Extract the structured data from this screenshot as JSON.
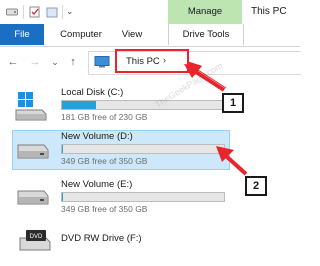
{
  "window": {
    "title": "This PC"
  },
  "ribbon": {
    "context_tab": "Manage",
    "tabs": {
      "file": "File",
      "computer": "Computer",
      "view": "View",
      "drive_tools": "Drive Tools"
    }
  },
  "navigation": {
    "back": "←",
    "forward": "→",
    "recent": "⌄",
    "up": "↑"
  },
  "address": {
    "location": "This PC",
    "chevron": "›"
  },
  "drives": [
    {
      "name": "Local Disk (C:)",
      "size": "181 GB free of 230 GB",
      "used_fraction": 0.21,
      "selected": false
    },
    {
      "name": "New Volume (D:)",
      "size": "349 GB free of 350 GB",
      "used_fraction": 0.003,
      "selected": true
    },
    {
      "name": "New Volume (E:)",
      "size": "349 GB free of 350 GB",
      "used_fraction": 0.003,
      "selected": false
    },
    {
      "name": "DVD RW Drive (F:)",
      "selected": false
    }
  ],
  "annotations": {
    "callout_1": "1",
    "callout_2": "2"
  },
  "watermark": "TheGeekPage.com",
  "colors": {
    "accent": "#1a6fc2",
    "manage": "#bde5b1",
    "highlight": "#e8242d",
    "selection": "#cde8fb",
    "bar_fill": "#26a0da"
  }
}
